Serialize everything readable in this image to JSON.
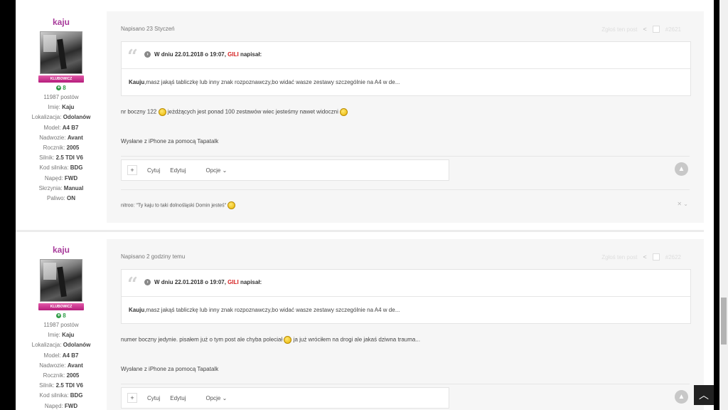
{
  "posts": [
    {
      "author": "kaju",
      "rank": "KLUBOWICZ",
      "reputation": "8",
      "post_count": "11987 postów",
      "fields": [
        {
          "label": "Imię:",
          "value": "Kaju"
        },
        {
          "label": "Lokalizacja:",
          "value": "Odolanów"
        },
        {
          "label": "Model:",
          "value": "A4 B7"
        },
        {
          "label": "Nadwozie:",
          "value": "Avant"
        },
        {
          "label": "Rocznik:",
          "value": "2005"
        },
        {
          "label": "Silnik:",
          "value": "2.5 TDI V6"
        },
        {
          "label": "Kod silnika:",
          "value": "BDG"
        },
        {
          "label": "Napęd:",
          "value": "FWD"
        },
        {
          "label": "Skrzynia:",
          "value": "Manual"
        },
        {
          "label": "Paliwo:",
          "value": "ON"
        }
      ],
      "posted": "Napisano 23 Styczeń",
      "report": "Zgłoś ten post",
      "number": "#2621",
      "quote_header_prefix": "W dniu 22.01.2018 o 19:07,",
      "quote_author": "GILI",
      "quote_header_suffix": "napisał:",
      "quote_bold": "Kauju",
      "quote_text": ",masz jakąś tabliczkę lub inny znak rozpoznawczy,bo widać wasze zestawy szczególnie na A4 w de...",
      "body_before": "nr boczny 122",
      "body_after": "jeżdżących jest ponad 100 zestawów wiec jesteśmy nawet widoczni",
      "footer": "Wysłane z iPhone za pomocą Tapatalk",
      "actions": {
        "quote": "Cytuj",
        "edit": "Edytuj",
        "options": "Opcje"
      },
      "signature": "nitroo: \"Ty kaju to taki dolnośląski Domin jesteś\""
    },
    {
      "author": "kaju",
      "rank": "KLUBOWICZ",
      "reputation": "8",
      "post_count": "11987 postów",
      "fields": [
        {
          "label": "Imię:",
          "value": "Kaju"
        },
        {
          "label": "Lokalizacja:",
          "value": "Odolanów"
        },
        {
          "label": "Model:",
          "value": "A4 B7"
        },
        {
          "label": "Nadwozie:",
          "value": "Avant"
        },
        {
          "label": "Rocznik:",
          "value": "2005"
        },
        {
          "label": "Silnik:",
          "value": "2.5 TDI V6"
        },
        {
          "label": "Kod silnika:",
          "value": "BDG"
        },
        {
          "label": "Napęd:",
          "value": "FWD"
        }
      ],
      "posted": "Napisano 2 godziny temu",
      "report": "Zgłoś ten post",
      "number": "#2622",
      "quote_header_prefix": "W dniu 22.01.2018 o 19:07,",
      "quote_author": "GILI",
      "quote_header_suffix": "napisał:",
      "quote_bold": "Kauju",
      "quote_text": ",masz jakąś tabliczkę lub inny znak rozpoznawczy,bo widać wasze zestawy szczególnie na A4 w de...",
      "body_before": "numer boczny jedynie. pisałem już o tym post ale chyba poleciał",
      "body_after": "ja już wróciłem na drogi ale jakaś dziwna trauma...",
      "footer": "Wysłane z iPhone za pomocą Tapatalk",
      "actions": {
        "quote": "Cytuj",
        "edit": "Edytuj",
        "options": "Opcje"
      }
    }
  ]
}
